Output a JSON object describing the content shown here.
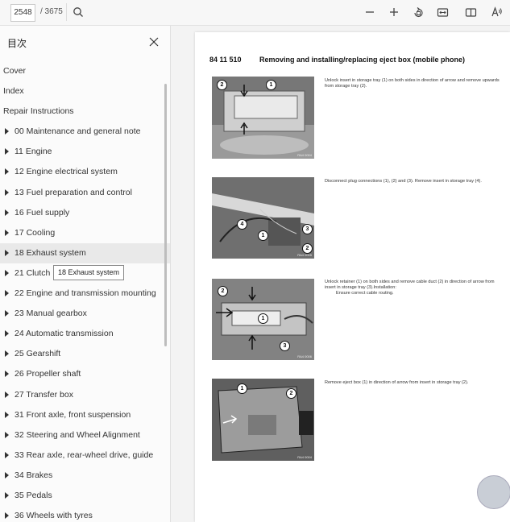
{
  "toolbar": {
    "page_current": "2548",
    "page_total": "/ 3675",
    "icons": [
      "search-icon",
      "zoom-out-icon",
      "zoom-in-icon",
      "rotate-icon",
      "fit-page-icon",
      "two-page-icon",
      "read-aloud-icon"
    ]
  },
  "sidebar": {
    "title": "目次",
    "tooltip": "18 Exhaust system",
    "items": [
      {
        "label": "Cover",
        "expandable": false
      },
      {
        "label": "Index",
        "expandable": false
      },
      {
        "label": "Repair Instructions",
        "expandable": false
      },
      {
        "label": "00 Maintenance and general note",
        "expandable": true
      },
      {
        "label": "11 Engine",
        "expandable": true
      },
      {
        "label": "12 Engine electrical system",
        "expandable": true
      },
      {
        "label": "13 Fuel preparation and control",
        "expandable": true
      },
      {
        "label": "16 Fuel supply",
        "expandable": true
      },
      {
        "label": "17 Cooling",
        "expandable": true
      },
      {
        "label": "18 Exhaust system",
        "expandable": true,
        "highlighted": true
      },
      {
        "label": "21 Clutch",
        "expandable": true
      },
      {
        "label": "22 Engine and transmission mounting",
        "expandable": true
      },
      {
        "label": "23 Manual gearbox",
        "expandable": true
      },
      {
        "label": "24 Automatic transmission",
        "expandable": true
      },
      {
        "label": "25 Gearshift",
        "expandable": true
      },
      {
        "label": "26 Propeller shaft",
        "expandable": true
      },
      {
        "label": "27 Transfer box",
        "expandable": true
      },
      {
        "label": "31 Front axle, front suspension",
        "expandable": true
      },
      {
        "label": "32 Steering and Wheel Alignment",
        "expandable": true
      },
      {
        "label": "33 Rear axle, rear-wheel drive, guide",
        "expandable": true
      },
      {
        "label": "34 Brakes",
        "expandable": true
      },
      {
        "label": "35 Pedals",
        "expandable": true
      },
      {
        "label": "36 Wheels with tyres",
        "expandable": true
      }
    ]
  },
  "document": {
    "number": "84 11 510",
    "title": "Removing and installing/replacing eject box (mobile phone)",
    "steps": [
      {
        "caption": "RA4 0004",
        "text": "Unlock insert in storage tray (1) on both sides in direction of arrow and remove upwards from storage tray (2).",
        "callouts": [
          "2",
          "1"
        ]
      },
      {
        "caption": "RA4 0005",
        "text": "Disconnect plug connections (1), (2) and (3). Remove insert in storage tray (4).",
        "callouts": [
          "4",
          "1",
          "3",
          "2"
        ]
      },
      {
        "caption": "RA4 0006",
        "text": "Unlock retainer (1) on both sides and remove cable duct (2) in direction of arrow from insert in storage tray (3).Installation:",
        "note": "Ensure correct cable routing.",
        "callouts": [
          "2",
          "1",
          "3"
        ]
      },
      {
        "caption": "RA4 0004",
        "text": "Remove eject box (1) in direction of arrow from insert in storage tray (2).",
        "callouts": [
          "1",
          "2"
        ]
      }
    ]
  }
}
